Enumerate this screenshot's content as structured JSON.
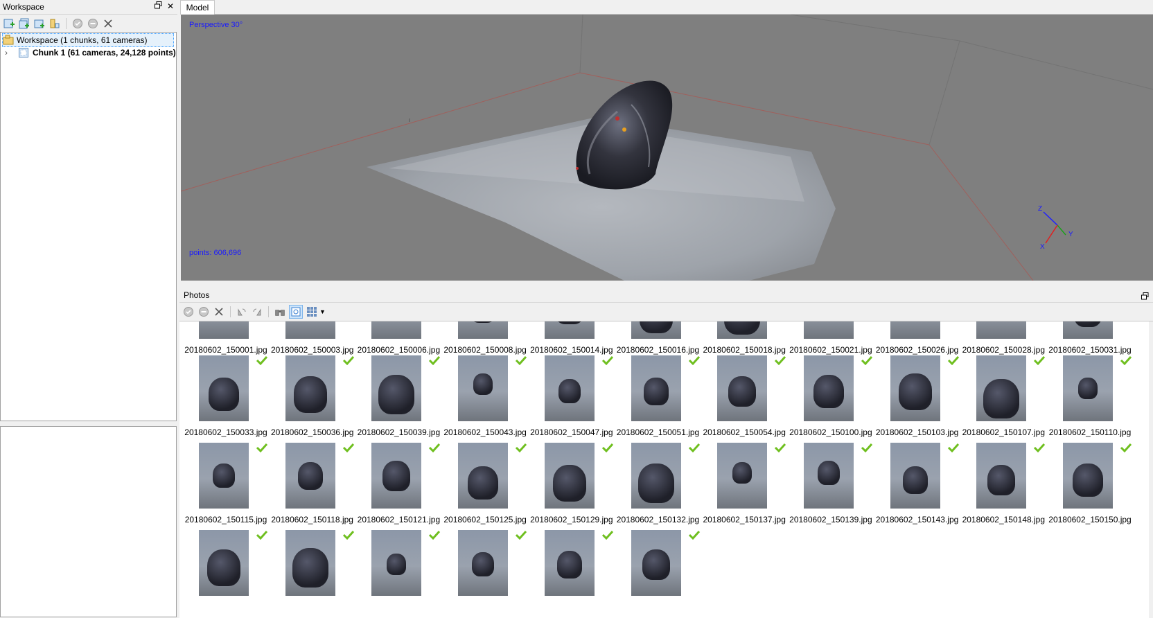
{
  "workspace": {
    "title": "Workspace",
    "tree": [
      {
        "label": "Workspace (1 chunks, 61 cameras)"
      },
      {
        "label": "Chunk 1 (61 cameras, 24,128 points)"
      }
    ],
    "toolbar_icons": [
      "add-chunk-icon",
      "add-photos-icon",
      "add-folder-icon",
      "import-icon",
      "enable-icon",
      "disable-icon",
      "remove-icon"
    ]
  },
  "model": {
    "tab_label": "Model",
    "projection_label": "Perspective 30°",
    "points_label": "points: 606,696",
    "axes": {
      "z": "Z",
      "y": "Y",
      "x": "X"
    }
  },
  "photos": {
    "title": "Photos",
    "toolbar_icons": [
      "enable-icon",
      "disable-icon",
      "remove-icon",
      "rotate-left-icon",
      "rotate-right-icon",
      "binoculars-icon",
      "filter-icon",
      "view-mode-icon"
    ],
    "items": [
      {
        "name": "20180602_150001.jpg",
        "checked": false
      },
      {
        "name": "20180602_150003.jpg",
        "checked": false
      },
      {
        "name": "20180602_150006.jpg",
        "checked": false
      },
      {
        "name": "20180602_150008.jpg",
        "checked": false
      },
      {
        "name": "20180602_150014.jpg",
        "checked": false
      },
      {
        "name": "20180602_150016.jpg",
        "checked": false
      },
      {
        "name": "20180602_150018.jpg",
        "checked": false
      },
      {
        "name": "20180602_150021.jpg",
        "checked": false
      },
      {
        "name": "20180602_150026.jpg",
        "checked": false
      },
      {
        "name": "20180602_150028.jpg",
        "checked": false
      },
      {
        "name": "20180602_150031.jpg",
        "checked": false
      },
      {
        "name": "20180602_150033.jpg",
        "checked": true
      },
      {
        "name": "20180602_150036.jpg",
        "checked": true
      },
      {
        "name": "20180602_150039.jpg",
        "checked": true
      },
      {
        "name": "20180602_150043.jpg",
        "checked": true
      },
      {
        "name": "20180602_150047.jpg",
        "checked": true
      },
      {
        "name": "20180602_150051.jpg",
        "checked": true
      },
      {
        "name": "20180602_150054.jpg",
        "checked": true
      },
      {
        "name": "20180602_150100.jpg",
        "checked": true
      },
      {
        "name": "20180602_150103.jpg",
        "checked": true
      },
      {
        "name": "20180602_150107.jpg",
        "checked": true
      },
      {
        "name": "20180602_150110.jpg",
        "checked": true
      },
      {
        "name": "20180602_150115.jpg",
        "checked": true
      },
      {
        "name": "20180602_150118.jpg",
        "checked": true
      },
      {
        "name": "20180602_150121.jpg",
        "checked": true
      },
      {
        "name": "20180602_150125.jpg",
        "checked": true
      },
      {
        "name": "20180602_150129.jpg",
        "checked": true
      },
      {
        "name": "20180602_150132.jpg",
        "checked": true
      },
      {
        "name": "20180602_150137.jpg",
        "checked": true
      },
      {
        "name": "20180602_150139.jpg",
        "checked": true
      },
      {
        "name": "20180602_150143.jpg",
        "checked": true
      },
      {
        "name": "20180602_150148.jpg",
        "checked": true
      },
      {
        "name": "20180602_150150.jpg",
        "checked": true
      },
      {
        "name": "",
        "checked": true
      },
      {
        "name": "",
        "checked": true
      },
      {
        "name": "",
        "checked": true
      },
      {
        "name": "",
        "checked": true
      },
      {
        "name": "",
        "checked": true
      },
      {
        "name": "",
        "checked": true
      }
    ]
  },
  "colors": {
    "accent_text": "#1a1aff",
    "check": "#6fbf1f",
    "viewport_bg": "#7f7f7f"
  }
}
